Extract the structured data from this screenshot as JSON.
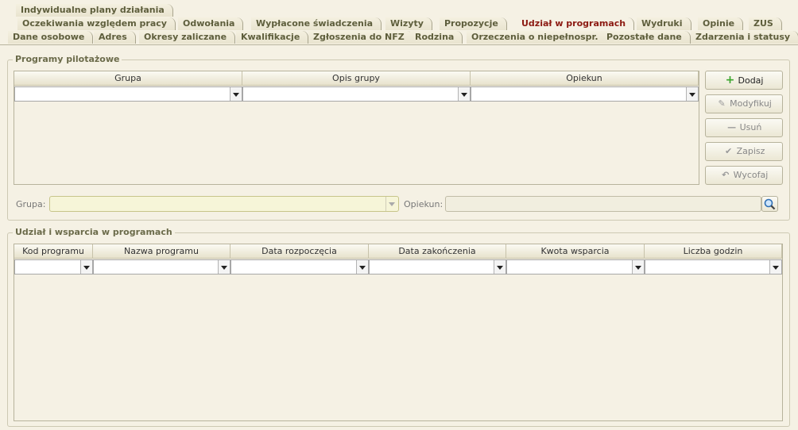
{
  "tabs": {
    "row1": [
      "Indywidualne plany działania"
    ],
    "row2": [
      "Oczekiwania względem pracy",
      "Odwołania",
      "Wypłacone świadczenia",
      "Wizyty",
      "Propozycje",
      "Udział w programach",
      "Wydruki",
      "Opinie",
      "ZUS"
    ],
    "row3": [
      "Dane osobowe",
      "Adres",
      "Okresy zaliczane",
      "Kwalifikacje",
      "Zgłoszenia do NFZ",
      "Rodzina",
      "Orzeczenia o niepełnospr.",
      "Pozostałe dane",
      "Zdarzenia i statusy"
    ],
    "active": "Udział w programach"
  },
  "pilot": {
    "legend": "Programy pilotażowe",
    "columns": [
      "Grupa",
      "Opis grupy",
      "Opiekun"
    ],
    "buttons": {
      "add": "Dodaj",
      "modify": "Modyfikuj",
      "delete": "Usuń",
      "save": "Zapisz",
      "undo": "Wycofaj"
    },
    "group_label": "Grupa:",
    "group_value": "",
    "guardian_label": "Opiekun:",
    "guardian_value": ""
  },
  "participation": {
    "legend": "Udział i wsparcia w programach",
    "columns": [
      "Kod programu",
      "Nazwa programu",
      "Data rozpoczęcia",
      "Data zakończenia",
      "Kwota wsparcia",
      "Liczba godzin"
    ]
  },
  "colors": {
    "background": "#f5f1e4",
    "active_tab": "#8c1a12",
    "tab_text": "#5e5e3c",
    "add_icon": "#3aa52c"
  },
  "icons": {
    "add": "plus-icon",
    "modify": "pencil-icon",
    "delete": "minus-icon",
    "save": "check-icon",
    "undo": "undo-icon",
    "search": "magnifier-icon"
  }
}
